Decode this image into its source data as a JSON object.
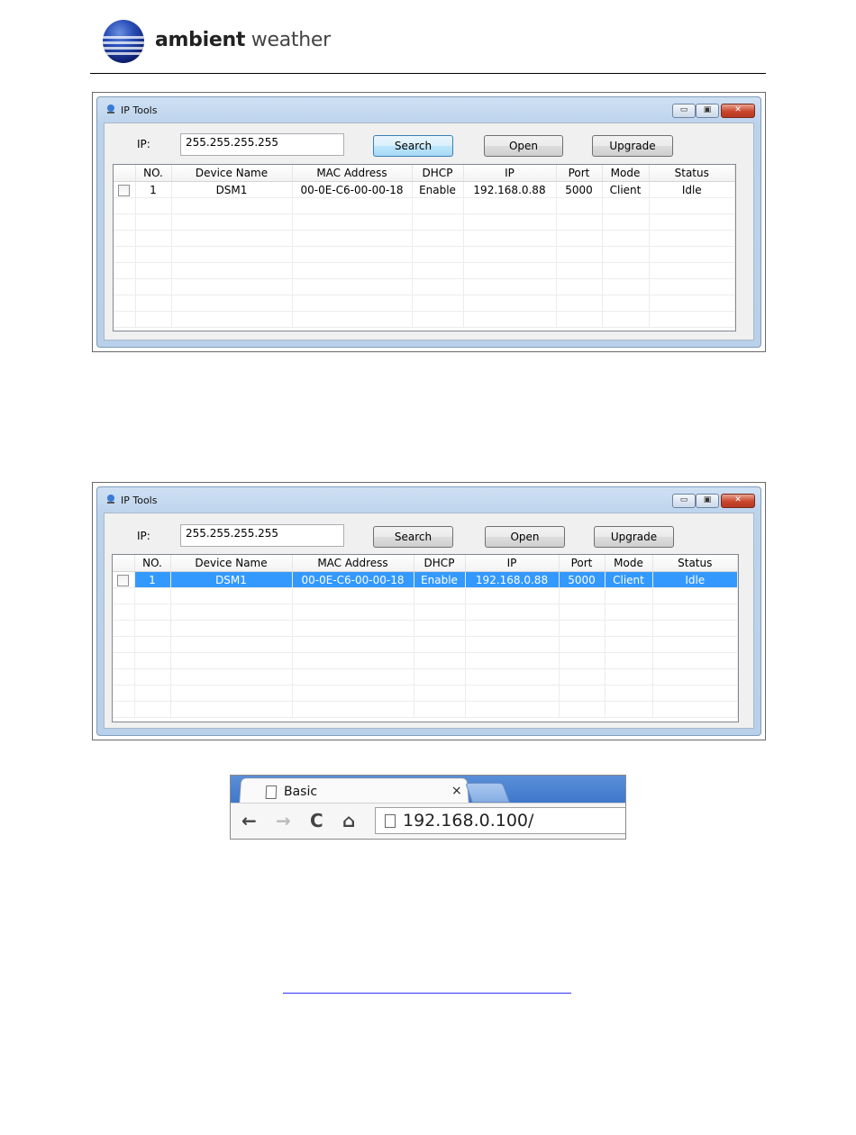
{
  "header": {
    "brand_bold": "ambient",
    "brand_light": "weather"
  },
  "window1": {
    "title": "IP Tools",
    "ip_label": "IP:",
    "ip_value": "255.255.255.255",
    "buttons": {
      "search": "Search",
      "open": "Open",
      "upgrade": "Upgrade"
    },
    "titlebar_buttons": {
      "minimize": "▭",
      "maximize": "▣",
      "close": "✕"
    },
    "columns": [
      "NO.",
      "Device Name",
      "MAC Address",
      "DHCP",
      "IP",
      "Port",
      "Mode",
      "Status"
    ],
    "rows": [
      {
        "no": "1",
        "device": "DSM1",
        "mac": "00-0E-C6-00-00-18",
        "dhcp": "Enable",
        "ip": "192.168.0.88",
        "port": "5000",
        "mode": "Client",
        "status": "Idle",
        "selected": false
      }
    ]
  },
  "window2": {
    "title": "IP Tools",
    "ip_label": "IP:",
    "ip_value": "255.255.255.255",
    "buttons": {
      "search": "Search",
      "open": "Open",
      "upgrade": "Upgrade"
    },
    "titlebar_buttons": {
      "minimize": "▭",
      "maximize": "▣",
      "close": "✕"
    },
    "columns": [
      "NO.",
      "Device Name",
      "MAC Address",
      "DHCP",
      "IP",
      "Port",
      "Mode",
      "Status"
    ],
    "rows": [
      {
        "no": "1",
        "device": "DSM1",
        "mac": "00-0E-C6-00-00-18",
        "dhcp": "Enable",
        "ip": "192.168.0.88",
        "port": "5000",
        "mode": "Client",
        "status": "Idle",
        "selected": true
      }
    ]
  },
  "browser": {
    "tab_title": "Basic",
    "tab_close": "×",
    "back": "←",
    "forward": "→",
    "reload": "C",
    "home": "⌂",
    "url": "192.168.0.100/"
  },
  "colors": {
    "selection": "#3399ff",
    "titlebar": "#bcd3ec",
    "browser_tabbar": "#4a82d2",
    "link": "#3333ff"
  }
}
